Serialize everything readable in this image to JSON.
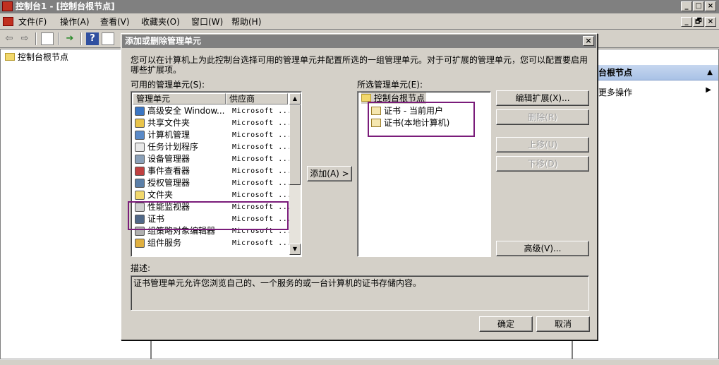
{
  "window": {
    "title": "控制台1 - [控制台根节点]",
    "min": "_",
    "max": "□",
    "close": "×",
    "restore": "🗗"
  },
  "menu": [
    "文件(F)",
    "操作(A)",
    "查看(V)",
    "收藏夹(O)",
    "窗口(W)",
    "帮助(H)"
  ],
  "tree": {
    "root": "控制台根节点"
  },
  "actions": {
    "header": "台根节点",
    "item": "更多操作"
  },
  "dialog": {
    "title": "添加或删除管理单元",
    "close": "×",
    "intro": "您可以在计算机上为此控制台选择可用的管理单元并配置所选的一组管理单元。对于可扩展的管理单元，您可以配置要启用哪些扩展项。",
    "available_label": "可用的管理单元(S):",
    "selected_label": "所选管理单元(E):",
    "columns": [
      "管理单元",
      "供应商"
    ],
    "available": [
      {
        "name": "高级安全 Window...",
        "vendor": "Microsoft ...",
        "icon": "firewall-icon",
        "color": "#3a76c4"
      },
      {
        "name": "共享文件夹",
        "vendor": "Microsoft ...",
        "icon": "shared-folder-icon",
        "color": "#e9c44a"
      },
      {
        "name": "计算机管理",
        "vendor": "Microsoft ...",
        "icon": "computer-management-icon",
        "color": "#5a8ac8"
      },
      {
        "name": "任务计划程序",
        "vendor": "Microsoft ...",
        "icon": "clock-icon",
        "color": "#e8e8e8"
      },
      {
        "name": "设备管理器",
        "vendor": "Microsoft ...",
        "icon": "device-manager-icon",
        "color": "#8aa0b8"
      },
      {
        "name": "事件查看器",
        "vendor": "Microsoft ...",
        "icon": "event-viewer-icon",
        "color": "#c04040"
      },
      {
        "name": "授权管理器",
        "vendor": "Microsoft ...",
        "icon": "authorization-icon",
        "color": "#5b7fa8"
      },
      {
        "name": "文件夹",
        "vendor": "Microsoft ...",
        "icon": "folder-icon",
        "color": "#f2d86c"
      },
      {
        "name": "性能监视器",
        "vendor": "Microsoft ...",
        "icon": "performance-icon",
        "color": "#d0d0d0"
      },
      {
        "name": "证书",
        "vendor": "Microsoft ...",
        "icon": "certificate-icon",
        "color": "#506888"
      },
      {
        "name": "组策略对象编辑器",
        "vendor": "Microsoft ...",
        "icon": "group-policy-icon",
        "color": "#b0b0b0"
      },
      {
        "name": "组件服务",
        "vendor": "Microsoft ...",
        "icon": "component-services-icon",
        "color": "#e0b040"
      }
    ],
    "add_button": "添加(A) >",
    "selected_root": "控制台根节点",
    "selected": [
      "证书 - 当前用户",
      "证书(本地计算机)"
    ],
    "edit_ext_button": "编辑扩展(X)...",
    "remove_button": "删除(R)",
    "move_up_button": "上移(U)",
    "move_down_button": "下移(D)",
    "advanced_button": "高级(V)...",
    "desc_label": "描述:",
    "description": "证书管理单元允许您浏览自己的、一个服务的或一台计算机的证书存储内容。",
    "ok_button": "确定",
    "cancel_button": "取消"
  }
}
